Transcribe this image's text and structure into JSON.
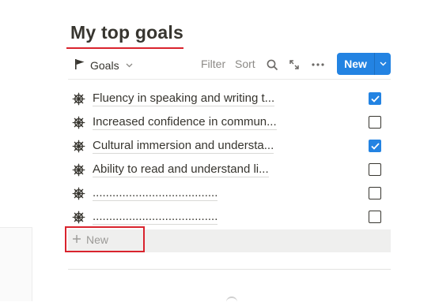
{
  "page": {
    "title": "My top goals"
  },
  "toolbar": {
    "view_name": "Goals",
    "view_icon": "flag-icon",
    "filter_label": "Filter",
    "sort_label": "Sort",
    "search_icon": "search-icon",
    "expand_icon": "expand-icon",
    "more_icon": "more-icon",
    "new_label": "New"
  },
  "goals": [
    {
      "label": "Fluency in speaking and writing t...",
      "checked": true,
      "icon": "ship-wheel-icon"
    },
    {
      "label": "Increased confidence in commun...",
      "checked": false,
      "icon": "ship-wheel-icon"
    },
    {
      "label": "Cultural immersion and understa...",
      "checked": true,
      "icon": "ship-wheel-icon"
    },
    {
      "label": "Ability to read and understand li...",
      "checked": false,
      "icon": "ship-wheel-icon"
    },
    {
      "label": "......................................",
      "checked": false,
      "icon": "ship-wheel-icon"
    },
    {
      "label": "......................................",
      "checked": false,
      "icon": "ship-wheel-icon"
    }
  ],
  "add_row": {
    "label": "New"
  },
  "colors": {
    "accent": "#2383e2",
    "highlight": "#d9232d",
    "text": "#37352f",
    "muted": "#8c8a86"
  }
}
